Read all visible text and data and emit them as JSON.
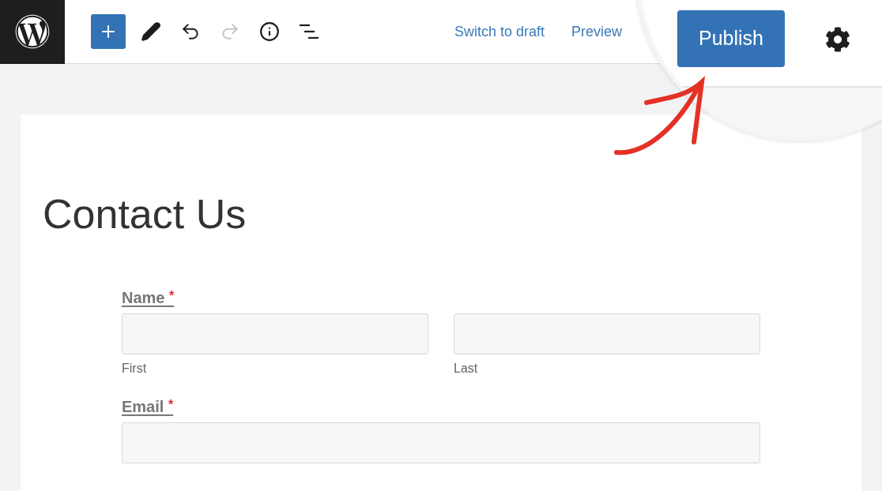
{
  "toolbar": {
    "tools": [
      {
        "kind": "add",
        "disabled": false
      },
      {
        "kind": "edit",
        "disabled": false
      },
      {
        "kind": "undo",
        "disabled": false
      },
      {
        "kind": "redo",
        "disabled": true
      },
      {
        "kind": "info",
        "disabled": false
      },
      {
        "kind": "outline",
        "disabled": false
      }
    ],
    "links": [
      "Switch to draft",
      "Preview"
    ],
    "publish_button": "Publish"
  },
  "page": {
    "title": "Contact Us",
    "fields": [
      {
        "kind": "split",
        "label": "Name",
        "required_mark": "*",
        "sublabels": [
          "First",
          "Last"
        ]
      },
      {
        "kind": "single",
        "label": "Email",
        "required_mark": "*"
      }
    ]
  }
}
